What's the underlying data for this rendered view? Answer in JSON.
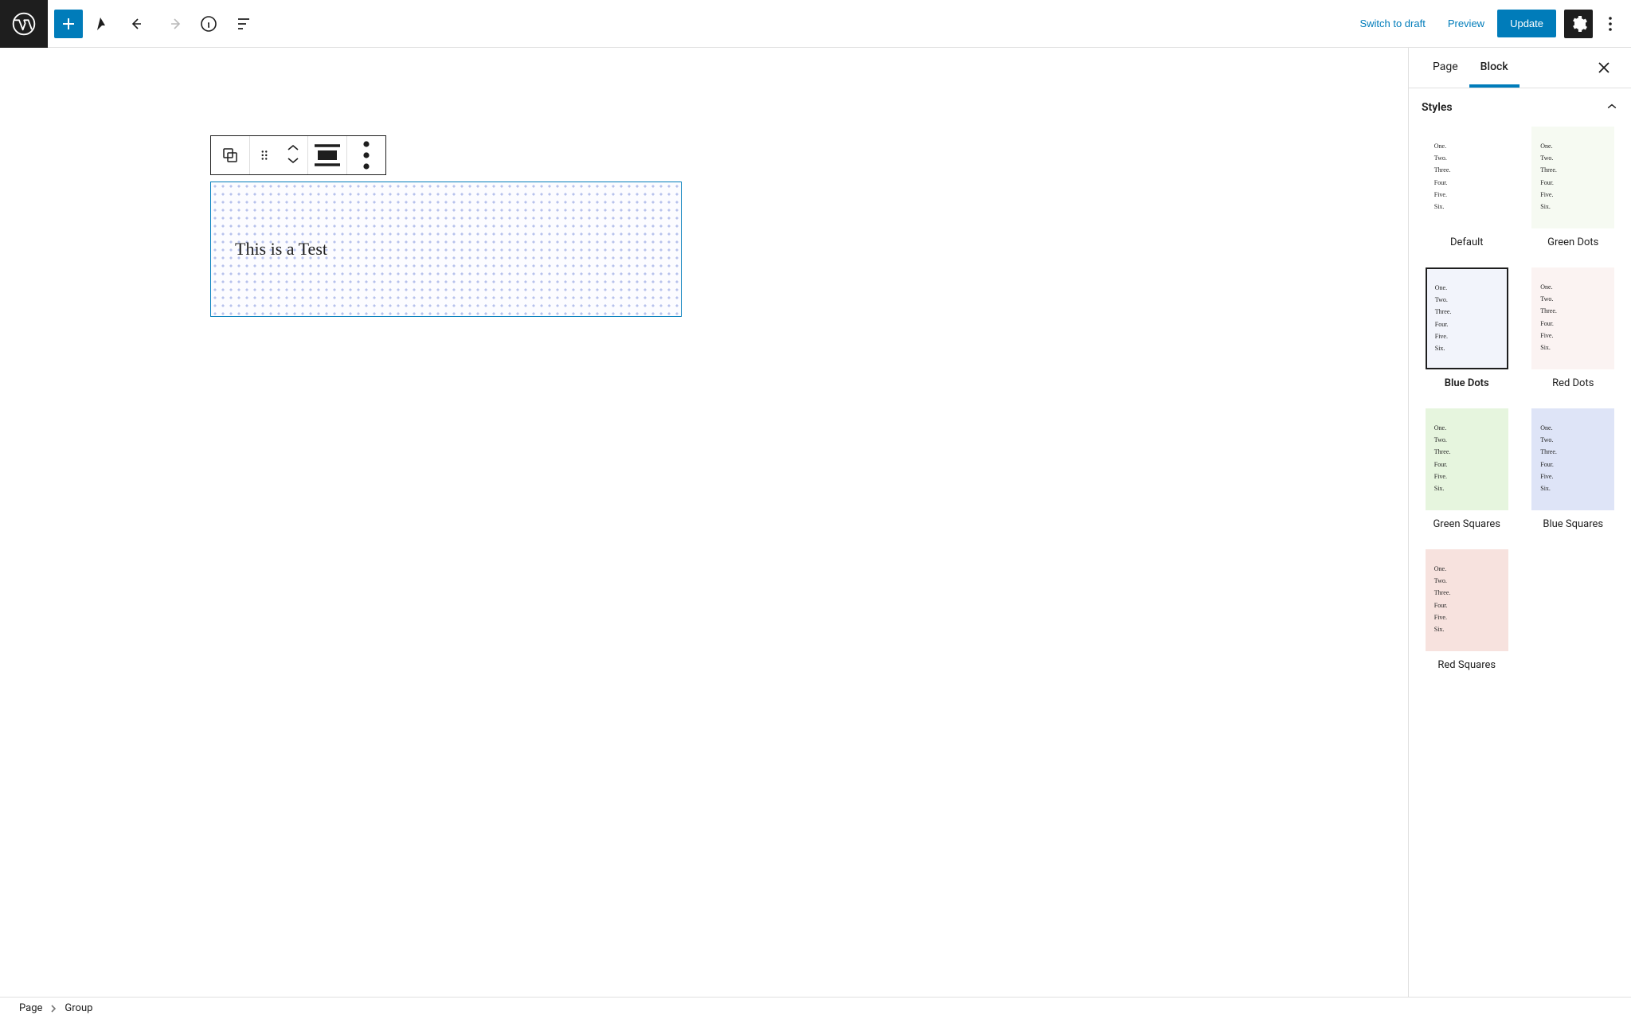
{
  "toolbar": {
    "switch_to_draft": "Switch to draft",
    "preview": "Preview",
    "update": "Update"
  },
  "block_content": "This is a Test",
  "sidebar": {
    "tab_page": "Page",
    "tab_block": "Block",
    "styles_heading": "Styles"
  },
  "preview_lines": [
    "One.",
    "Two.",
    "Three.",
    "Four.",
    "Five.",
    "Six."
  ],
  "styles": {
    "default": "Default",
    "green_dots": "Green Dots",
    "blue_dots": "Blue Dots",
    "red_dots": "Red Dots",
    "green_squares": "Green Squares",
    "blue_squares": "Blue Squares",
    "red_squares": "Red Squares"
  },
  "selected_style": "blue_dots",
  "breadcrumb": {
    "page": "Page",
    "group": "Group"
  }
}
